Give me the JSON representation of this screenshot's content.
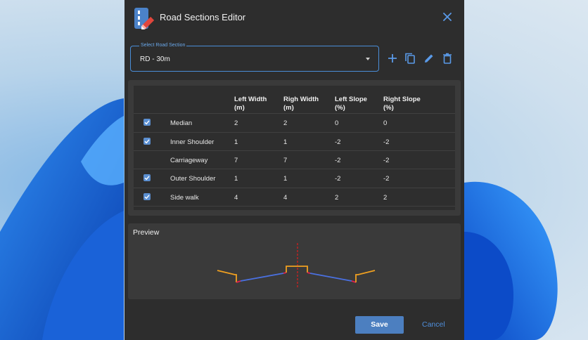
{
  "dialog": {
    "title": "Road Sections Editor",
    "icon": "road-pencil-icon",
    "close_icon": "close-icon"
  },
  "select": {
    "legend": "Select Road Section",
    "value": "RD - 30m"
  },
  "toolbar": {
    "add_icon": "plus-icon",
    "copy_icon": "copy-icon",
    "edit_icon": "pencil-icon",
    "delete_icon": "trash-icon"
  },
  "table": {
    "headers": {
      "left_width": [
        "Left Width",
        "(m)"
      ],
      "right_width": [
        "Righ Width",
        "(m)"
      ],
      "left_slope": [
        "Left Slope",
        "(%)"
      ],
      "right_slope": [
        "Right Slope",
        "(%)"
      ]
    },
    "rows": [
      {
        "checked": true,
        "name": "Median",
        "left_width": "2",
        "right_width": "2",
        "left_slope": "0",
        "right_slope": "0"
      },
      {
        "checked": true,
        "name": "Inner Shoulder",
        "left_width": "1",
        "right_width": "1",
        "left_slope": "-2",
        "right_slope": "-2"
      },
      {
        "checked": false,
        "name": "Carriageway",
        "left_width": "7",
        "right_width": "7",
        "left_slope": "-2",
        "right_slope": "-2"
      },
      {
        "checked": true,
        "name": "Outer Shoulder",
        "left_width": "1",
        "right_width": "1",
        "left_slope": "-2",
        "right_slope": "-2"
      },
      {
        "checked": true,
        "name": "Side walk",
        "left_width": "4",
        "right_width": "4",
        "left_slope": "2",
        "right_slope": "2"
      }
    ]
  },
  "preview": {
    "title": "Preview"
  },
  "buttons": {
    "save": "Save",
    "cancel": "Cancel"
  },
  "colors": {
    "accent": "#4c7fc0",
    "sidewalk": "#f0a020",
    "carriageway": "#4a70e0",
    "shoulder": "#e02050",
    "centerline": "#d02020"
  }
}
